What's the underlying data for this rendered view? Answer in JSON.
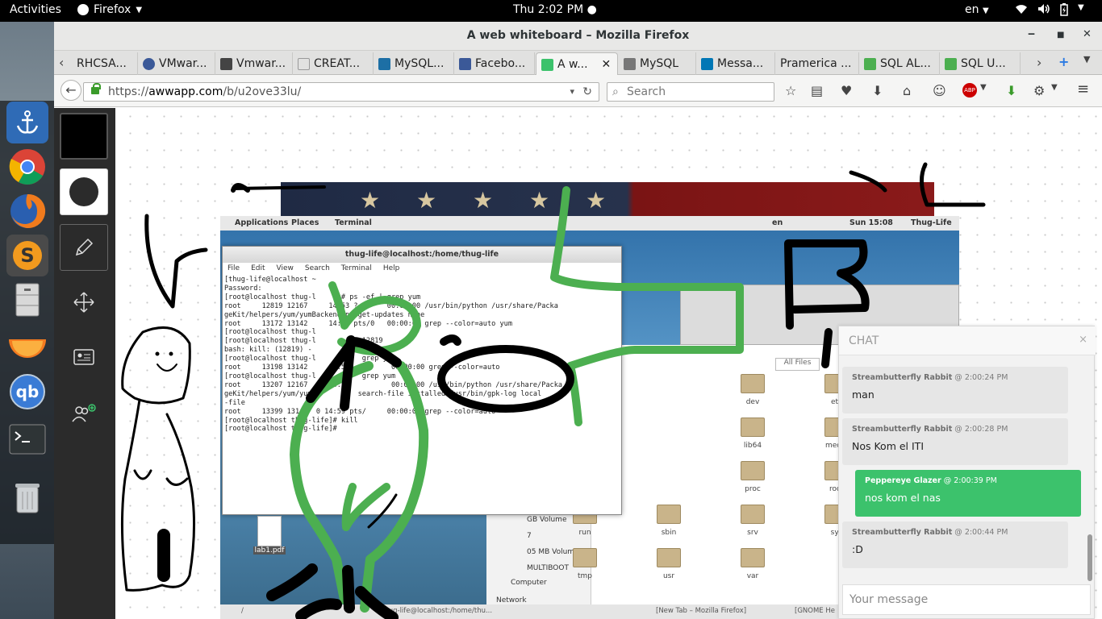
{
  "topbar": {
    "activities": "Activities",
    "app": "Firefox",
    "clock": "Thu  2:02 PM",
    "lang": "en"
  },
  "window": {
    "title": "A web whiteboard – Mozilla Firefox"
  },
  "tabs": [
    {
      "label": "RHCSA...",
      "fav_color": "#888888"
    },
    {
      "label": "VMwar...",
      "fav_color": "#3b5998"
    },
    {
      "label": "Vmwar...",
      "fav_color": "#444444"
    },
    {
      "label": "CREAT...",
      "fav_color": "#999999"
    },
    {
      "label": "MySQL...",
      "fav_color": "#1d6fa5"
    },
    {
      "label": "Facebo...",
      "fav_color": "#3b5998"
    },
    {
      "label": "A w...",
      "fav_color": "#3cc26c"
    },
    {
      "label": "MySQL",
      "fav_color": "#777777"
    },
    {
      "label": "Messa...",
      "fav_color": "#0077b5"
    },
    {
      "label": "Pramerica ...",
      "fav_color": "#cccccc"
    },
    {
      "label": "SQL AL...",
      "fav_color": "#4caf50"
    },
    {
      "label": "SQL U...",
      "fav_color": "#4caf50"
    }
  ],
  "nav": {
    "url_prefix": "https://",
    "url_host": "awwapp.com",
    "url_path": "/b/u2ove33lu/",
    "search_placeholder": "Search"
  },
  "chat": {
    "title": "CHAT",
    "close": "×",
    "messages": [
      {
        "author": "Streambutterfly Rabbit",
        "time": "@ 2:00:24 PM",
        "text": "man",
        "mine": false
      },
      {
        "author": "Streambutterfly Rabbit",
        "time": "@ 2:00:28 PM",
        "text": "Nos Kom el ITI",
        "mine": false
      },
      {
        "author": "Peppereye Glazer",
        "time": "@ 2:00:39 PM",
        "text": "nos kom el nas",
        "mine": true
      },
      {
        "author": "Streambutterfly Rabbit",
        "time": "@ 2:00:44 PM",
        "text": ":D",
        "mine": false
      }
    ],
    "input_placeholder": "Your message"
  },
  "embedded_screenshot": {
    "topbar_left": "Applications",
    "places": "Places",
    "terminal_label": "Terminal",
    "clock": "Sun 15:08",
    "user": "Thug-Life",
    "terminal_title": "thug-life@localhost:/home/thug-life",
    "terminal_menu": [
      "File",
      "Edit",
      "View",
      "Search",
      "Terminal",
      "Help"
    ],
    "terminal_lines": [
      "[thug-life@localhost ~",
      "Password:",
      "[root@localhost thug-l     ]# ps -ef | grep yum",
      "root     12819 12167     14:53 ?       00:00:00 /usr/bin/python /usr/share/Packa",
      "geKit/helpers/yum/yumBackend.py get-updates none",
      "root     13172 13142     14:57 pts/0   00:00:00 grep --color=auto yum",
      "[root@localhost thug-l",
      "[root@localhost thug-l           12819",
      "bash: kill: (12819) -",
      "[root@localhost thug-l           grep yum",
      "root     13198 13142     14:58          00:00:00 grep --color=auto",
      "[root@localhost thug-l           grep yum",
      "root     13207 12167     14:58          00:00:00 /usr/bin/python /usr/share/Packa",
      "geKit/helpers/yum/yum           search-file installed /usr/bin/gpk-log local",
      "-file",
      "root     13399 13142  0 14:59 pts/     00:00:00 grep --color=auto",
      "[root@localhost thug-life]# kill",
      "[root@localhost thug-life]# "
    ],
    "folders": [
      {
        "name": "dev"
      },
      {
        "name": "etc"
      },
      {
        "name": "lib64"
      },
      {
        "name": "media"
      },
      {
        "name": "proc"
      },
      {
        "name": "root"
      },
      {
        "name": "run"
      },
      {
        "name": "sbin"
      },
      {
        "name": "srv"
      },
      {
        "name": "sys"
      },
      {
        "name": "tmp"
      },
      {
        "name": "usr"
      },
      {
        "name": "var"
      }
    ],
    "sidebar": [
      "GB Volume",
      "7",
      "05 MB Volume",
      "MULTIBOOT",
      "Computer",
      "Network"
    ],
    "all_files": "All Files",
    "desktop_file": "lab1.pdf",
    "taskbar": [
      "/",
      "thug-life@localhost:/home/thu...",
      "[New Tab – Mozilla Firefox]",
      "[GNOME He"
    ]
  },
  "colors": {
    "accent_green": "#3cc26c",
    "ink_green": "#4caf50",
    "ink_black": "#000000"
  }
}
